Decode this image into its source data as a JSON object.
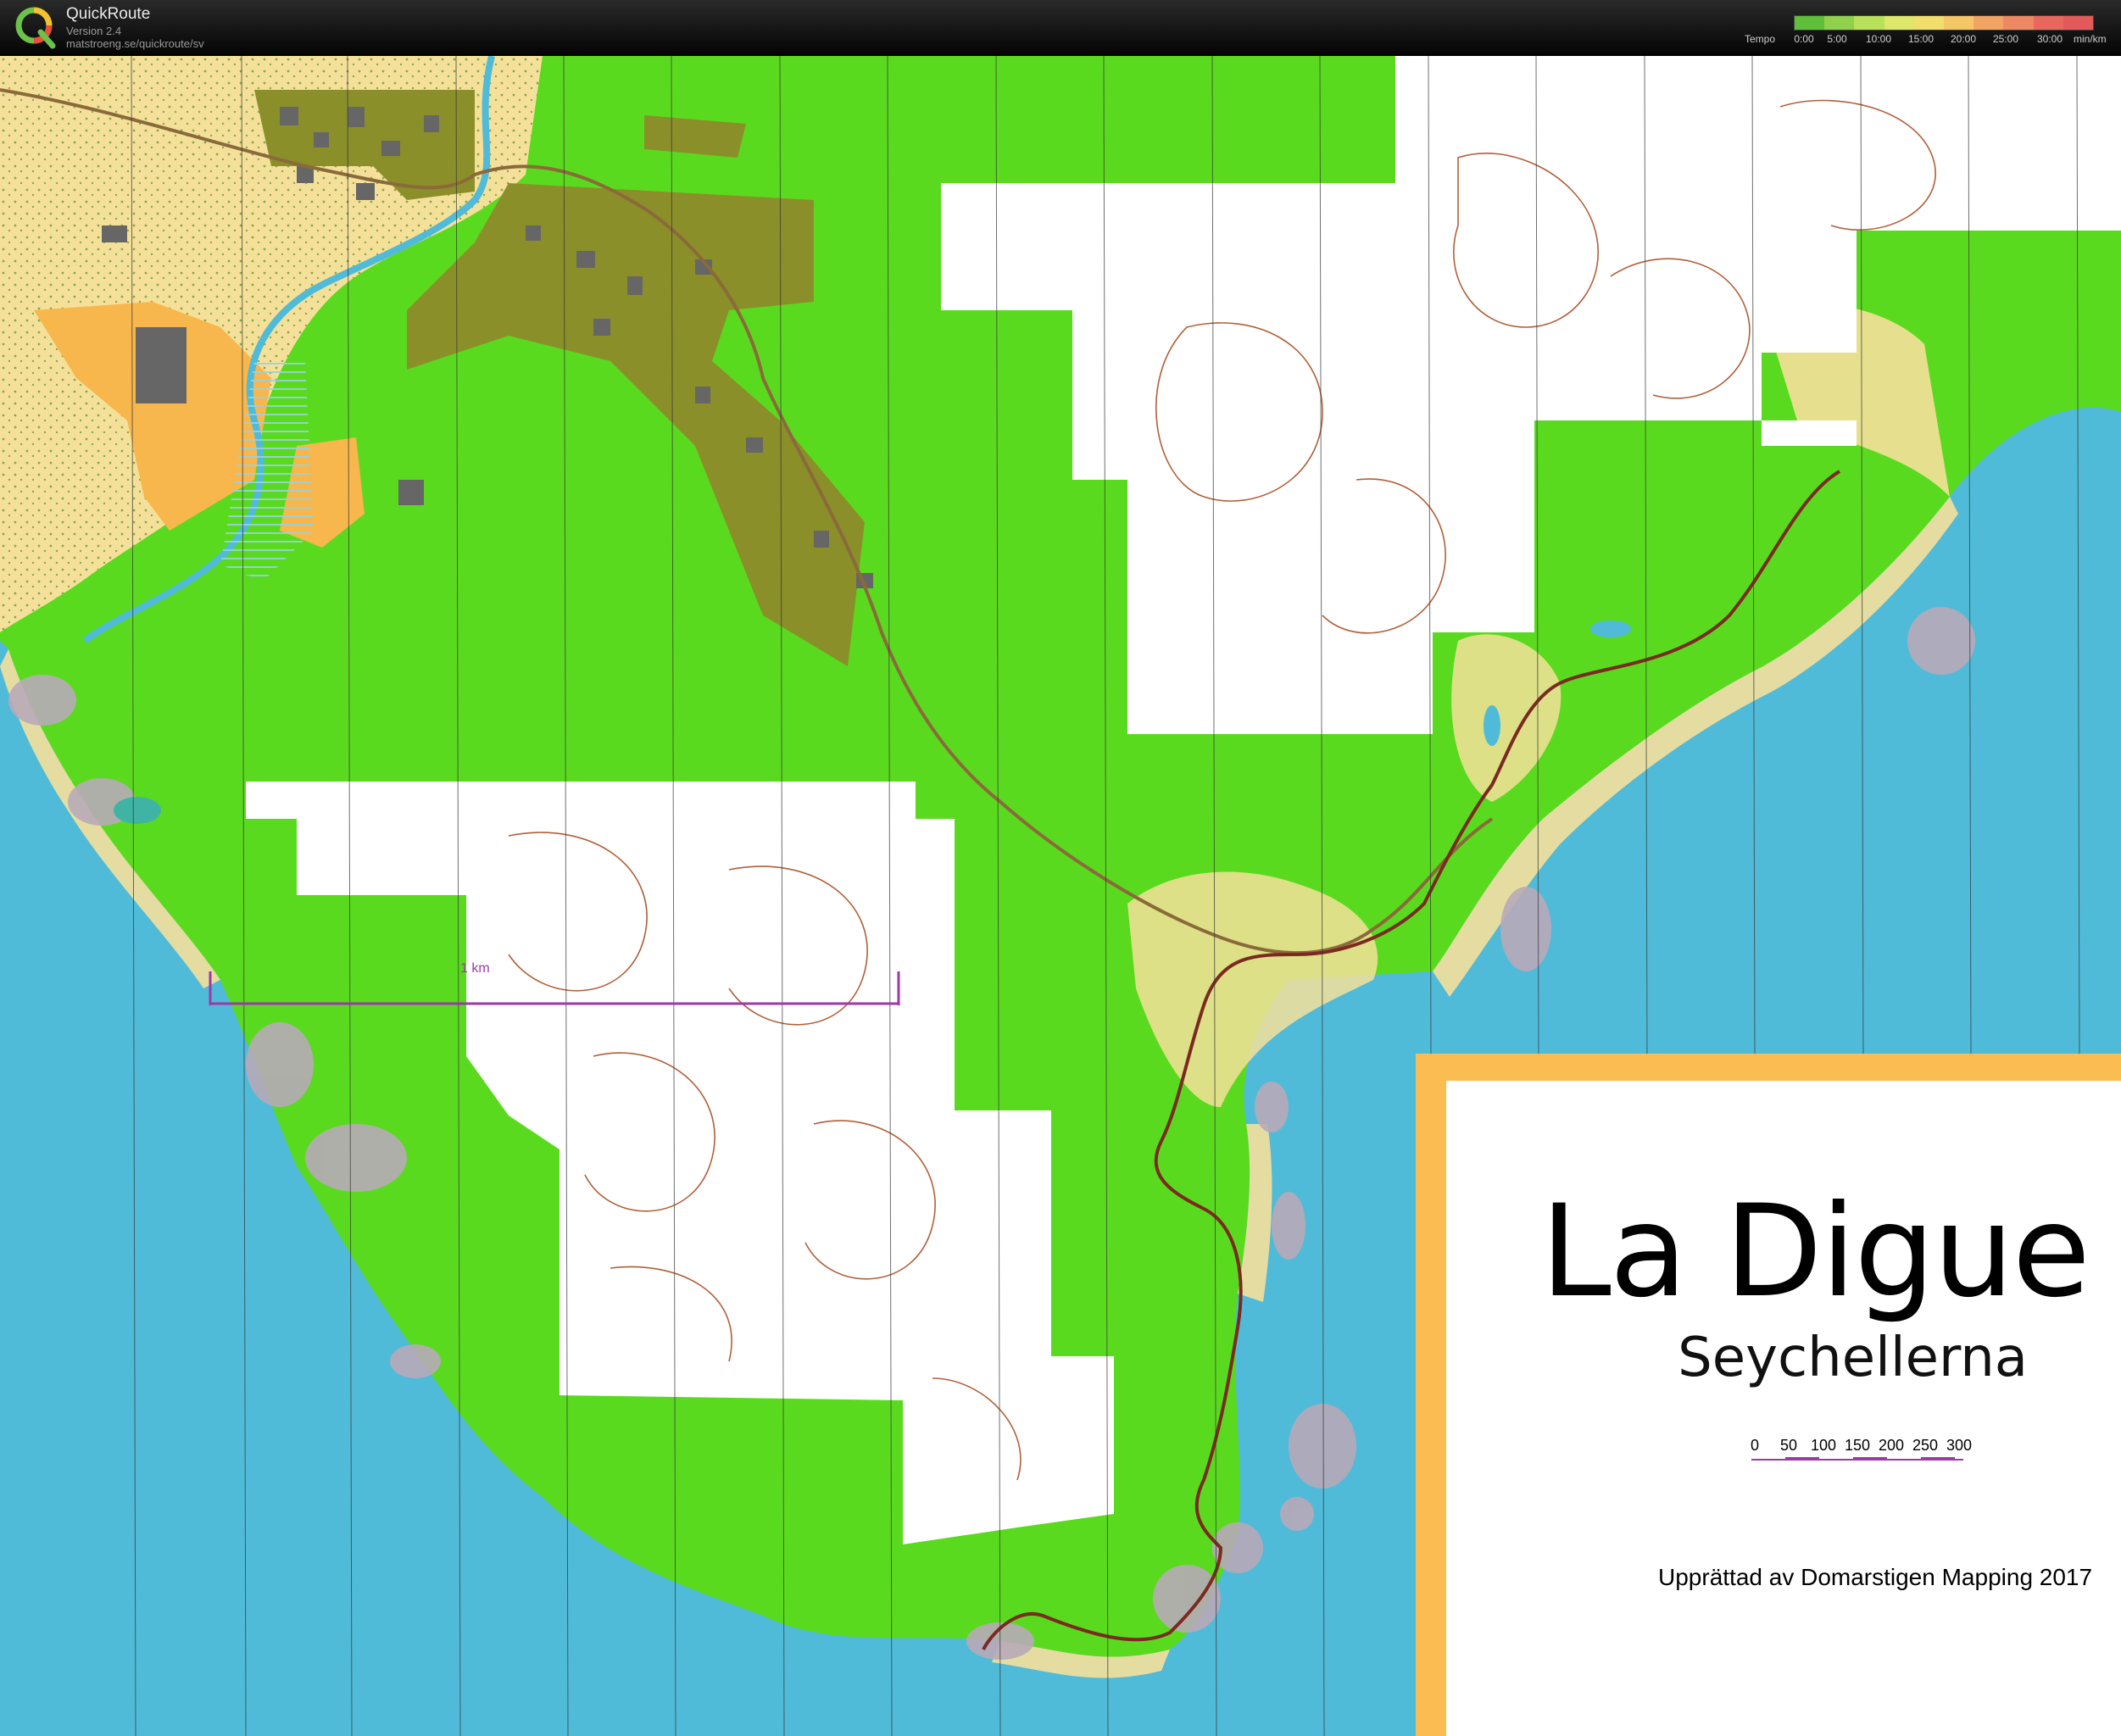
{
  "app": {
    "name": "QuickRoute",
    "version": "Version 2.4",
    "url": "matstroeng.se/quickroute/sv",
    "logo_icon": "quickroute-q-logo-icon"
  },
  "tempo_scale": {
    "label": "Tempo",
    "ticks": [
      "0:00",
      "5:00",
      "10:00",
      "15:00",
      "20:00",
      "25:00",
      "30:00"
    ],
    "unit": "min/km",
    "colors": [
      "#5fbf3a",
      "#8fd14a",
      "#b9e05a",
      "#dde86a",
      "#f2de6a",
      "#f5c665",
      "#f2a462",
      "#ee8862",
      "#e8685e",
      "#e25a5a"
    ]
  },
  "map": {
    "scale_bar_label": "1 km",
    "colors": {
      "water": "#4fbbd9",
      "forest": "#5ada1e",
      "open": "#f5e09a",
      "settlement": "#f7b74c",
      "dense": "#8a8f2a",
      "unmapped": "#ffffff",
      "contour": "#b0603a",
      "route": "#7a2a20",
      "rock": "#b8aab8",
      "scale": "#9b3aa8"
    }
  },
  "legend": {
    "title": "La Digue",
    "subtitle": "Seychellerna",
    "scale_ticks": [
      "0",
      "50",
      "100",
      "150",
      "200",
      "250",
      "300"
    ],
    "credit": "Upprättad av Domarstigen Mapping 2017",
    "frame_color": "#fbbd52"
  }
}
